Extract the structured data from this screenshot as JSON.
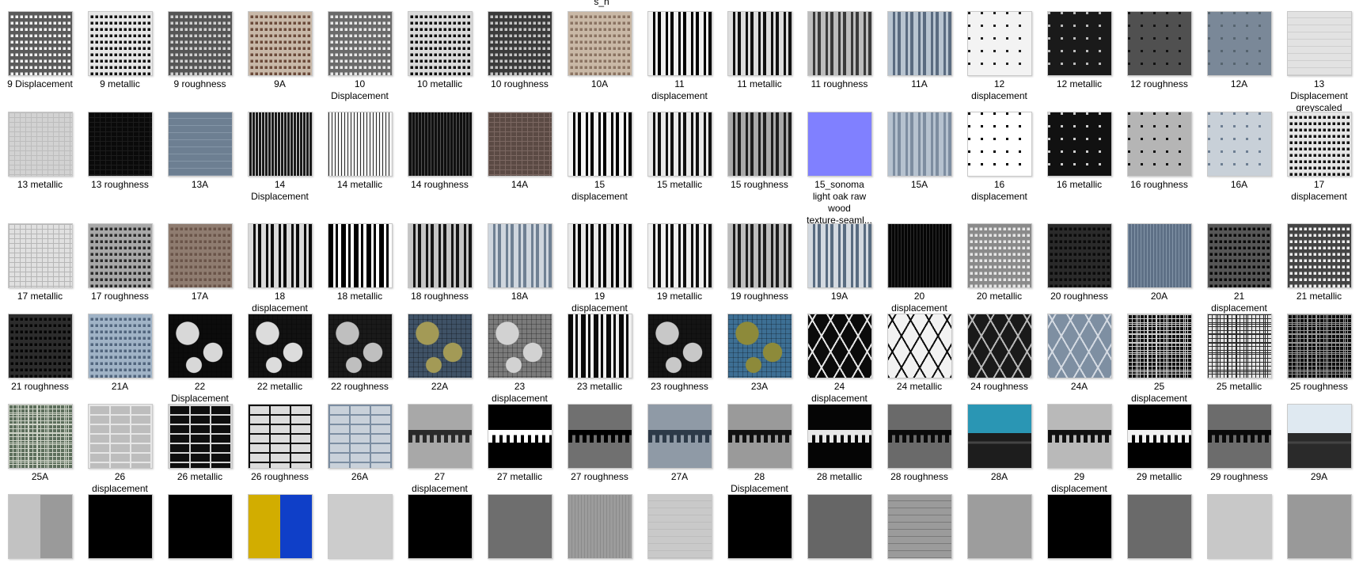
{
  "header_fragment": "s_n",
  "rows": [
    [
      {
        "label": "9 Displacement",
        "style": "grid",
        "bg": "#f2f2f2",
        "fg": "#5a5a5a"
      },
      {
        "label": "9 metallic",
        "style": "grid",
        "bg": "#101010",
        "fg": "#e6e6e6"
      },
      {
        "label": "9 roughness",
        "style": "grid",
        "bg": "#d0d0d0",
        "fg": "#555555"
      },
      {
        "label": "9A",
        "style": "grid",
        "bg": "#6b4a3a",
        "fg": "#c8b8a8"
      },
      {
        "label": "10\nDisplacement",
        "style": "grid",
        "bg": "#e8e8e8",
        "fg": "#6a6a6a"
      },
      {
        "label": "10 metallic",
        "style": "grid",
        "bg": "#0c0c0c",
        "fg": "#dadada"
      },
      {
        "label": "10 roughness",
        "style": "grid",
        "bg": "#c4c4c4",
        "fg": "#3a3a3a"
      },
      {
        "label": "10A",
        "style": "grid",
        "bg": "#8a7362",
        "fg": "#c9b8a6"
      },
      {
        "label": "11\ndisplacement",
        "style": "vbars",
        "bg": "#000000",
        "fg": "#f0f0f0"
      },
      {
        "label": "11 metallic",
        "style": "vbars",
        "bg": "#111111",
        "fg": "#dddddd"
      },
      {
        "label": "11 roughness",
        "style": "vbars",
        "bg": "#3a3a3a",
        "fg": "#bdbdbd"
      },
      {
        "label": "11A",
        "style": "vbars",
        "bg": "#5a6b80",
        "fg": "#b8c4d0"
      },
      {
        "label": "12\ndisplacement",
        "style": "checker",
        "bg": "#f3f3f3",
        "fg": "#202020"
      },
      {
        "label": "12 metallic",
        "style": "checker",
        "bg": "#1a1a1a",
        "fg": "#bcbcbc"
      },
      {
        "label": "12 roughness",
        "style": "checker",
        "bg": "#505050",
        "fg": "#111111"
      },
      {
        "label": "12A",
        "style": "checker",
        "bg": "#7a8898",
        "fg": "#56646f"
      },
      {
        "label": "13\nDisplacement\ngreyscaled",
        "style": "hstripes",
        "bg": "#e2e2e2",
        "fg": "#cfcfcf"
      }
    ],
    [
      {
        "label": "13 metallic",
        "style": "fine",
        "bg": "#d2d2d2",
        "fg": "#bdbdbd"
      },
      {
        "label": "13 roughness",
        "style": "fine",
        "bg": "#0a0a0a",
        "fg": "#1c1c1c"
      },
      {
        "label": "13A",
        "style": "hstripes",
        "bg": "#6d7f92",
        "fg": "#8495a7"
      },
      {
        "label": "14\nDisplacement",
        "style": "vlines",
        "bg": "#1a1a1a",
        "fg": "#e3e3e3"
      },
      {
        "label": "14 metallic",
        "style": "vlines",
        "bg": "#f2f2f2",
        "fg": "#2a2a2a"
      },
      {
        "label": "14 roughness",
        "style": "vlines",
        "bg": "#101010",
        "fg": "#555555"
      },
      {
        "label": "14A",
        "style": "fine",
        "bg": "#5b4a44",
        "fg": "#7b6761"
      },
      {
        "label": "15\ndisplacement",
        "style": "vbars",
        "bg": "#000000",
        "fg": "#f5f5f5"
      },
      {
        "label": "15 metallic",
        "style": "vbars",
        "bg": "#111111",
        "fg": "#e9e9e9"
      },
      {
        "label": "15 roughness",
        "style": "vbars",
        "bg": "#1e1e1e",
        "fg": "#a9a9a9"
      },
      {
        "label": "15_sonoma\nlight oak raw\nwood\ntexture-seaml...",
        "style": "solid",
        "bg": "#8080ff",
        "fg": "#8080ff"
      },
      {
        "label": "15A",
        "style": "vbars",
        "bg": "#7d8da0",
        "fg": "#b6c2cf"
      },
      {
        "label": "16\ndisplacement",
        "style": "checker",
        "bg": "#ffffff",
        "fg": "#000000"
      },
      {
        "label": "16 metallic",
        "style": "checker",
        "bg": "#111111",
        "fg": "#cfcfcf"
      },
      {
        "label": "16 roughness",
        "style": "checker",
        "bg": "#b5b5b5",
        "fg": "#0d0d0d"
      },
      {
        "label": "16A",
        "style": "checker",
        "bg": "#c8d0d8",
        "fg": "#6d7e92"
      },
      {
        "label": "17\ndisplacement",
        "style": "grid",
        "bg": "#121212",
        "fg": "#e6e6e6"
      }
    ],
    [
      {
        "label": "17 metallic",
        "style": "fine",
        "bg": "#e0e0e0",
        "fg": "#b6b6b6"
      },
      {
        "label": "17 roughness",
        "style": "grid",
        "bg": "#2a2a2a",
        "fg": "#a8a8a8"
      },
      {
        "label": "17A",
        "style": "grid",
        "bg": "#6a5449",
        "fg": "#8f7c70"
      },
      {
        "label": "18\ndisplacement",
        "style": "vbars",
        "bg": "#0a0a0a",
        "fg": "#d9d9d9"
      },
      {
        "label": "18 metallic",
        "style": "vbars",
        "bg": "#ffffff",
        "fg": "#000000"
      },
      {
        "label": "18 roughness",
        "style": "vbars",
        "bg": "#151515",
        "fg": "#c5c5c5"
      },
      {
        "label": "18A",
        "style": "vbars",
        "bg": "#6f8093",
        "fg": "#cfd6de"
      },
      {
        "label": "19\ndisplacement",
        "style": "vbars",
        "bg": "#000000",
        "fg": "#e8e8e8"
      },
      {
        "label": "19 metallic",
        "style": "vbars",
        "bg": "#101010",
        "fg": "#f0f0f0"
      },
      {
        "label": "19 roughness",
        "style": "vbars",
        "bg": "#1d1d1d",
        "fg": "#bdbdbd"
      },
      {
        "label": "19A",
        "style": "vbars",
        "bg": "#586b80",
        "fg": "#d3d9e0"
      },
      {
        "label": "20\ndisplacement",
        "style": "vlines",
        "bg": "#060606",
        "fg": "#2e2e2e"
      },
      {
        "label": "20 metallic",
        "style": "grid",
        "bg": "#e6e6e6",
        "fg": "#8a8a8a"
      },
      {
        "label": "20 roughness",
        "style": "grid",
        "bg": "#0a0a0a",
        "fg": "#2a2a2a"
      },
      {
        "label": "20A",
        "style": "vlines",
        "bg": "#5e7086",
        "fg": "#8395a8"
      },
      {
        "label": "21\ndisplacement",
        "style": "grid",
        "bg": "#090909",
        "fg": "#565656"
      },
      {
        "label": "21 metallic",
        "style": "grid",
        "bg": "#eeeeee",
        "fg": "#444444"
      }
    ],
    [
      {
        "label": "21 roughness",
        "style": "grid",
        "bg": "#050505",
        "fg": "#2c2c2c"
      },
      {
        "label": "21A",
        "style": "grid",
        "bg": "#51657d",
        "fg": "#a0b3c6"
      },
      {
        "label": "22\nDisplacement",
        "style": "blotch",
        "bg": "#0c0c0c",
        "fg": "#d8d8d8"
      },
      {
        "label": "22 metallic",
        "style": "blotch",
        "bg": "#121212",
        "fg": "#dcdcdc"
      },
      {
        "label": "22 roughness",
        "style": "blotch",
        "bg": "#1a1a1a",
        "fg": "#bfbfbf"
      },
      {
        "label": "22A",
        "style": "blotch",
        "bg": "#3f5266",
        "fg": "#a39a56"
      },
      {
        "label": "23\ndisplacement",
        "style": "blotch",
        "bg": "#7a7a7a",
        "fg": "#d2d2d2"
      },
      {
        "label": "23 metallic",
        "style": "vbars",
        "bg": "#f0f0f0",
        "fg": "#0a0a0a"
      },
      {
        "label": "23 roughness",
        "style": "blotch",
        "bg": "#141414",
        "fg": "#c8c8c8"
      },
      {
        "label": "23A",
        "style": "blotch",
        "bg": "#3d6f94",
        "fg": "#8d8a3a"
      },
      {
        "label": "24\ndisplacement",
        "style": "diamond",
        "bg": "#0b0b0b",
        "fg": "#e6e6e6"
      },
      {
        "label": "24 metallic",
        "style": "diamond",
        "bg": "#f2f2f2",
        "fg": "#0d0d0d"
      },
      {
        "label": "24 roughness",
        "style": "diamond",
        "bg": "#1a1a1a",
        "fg": "#b8b8b8"
      },
      {
        "label": "24A",
        "style": "diamond",
        "bg": "#7e8fa2",
        "fg": "#d4dae2"
      },
      {
        "label": "25\ndisplacement",
        "style": "circuit",
        "bg": "#101010",
        "fg": "#cfcfcf"
      },
      {
        "label": "25 metallic",
        "style": "circuit",
        "bg": "#e4e4e4",
        "fg": "#2a2a2a"
      },
      {
        "label": "25 roughness",
        "style": "circuit",
        "bg": "#0d0d0d",
        "fg": "#9a9a9a"
      }
    ],
    [
      {
        "label": "25A",
        "style": "circuit",
        "bg": "#5c6e5b",
        "fg": "#cfd4c8"
      },
      {
        "label": "26\ndisplacement",
        "style": "brick",
        "bg": "#bdbdbd",
        "fg": "#e6e6e6"
      },
      {
        "label": "26 metallic",
        "style": "brick",
        "bg": "#0e0e0e",
        "fg": "#d4d4d4"
      },
      {
        "label": "26 roughness",
        "style": "brick",
        "bg": "#dcdcdc",
        "fg": "#0c0c0c"
      },
      {
        "label": "26A",
        "style": "brick",
        "bg": "#c9d1da",
        "fg": "#7b8da1"
      },
      {
        "label": "27\ndisplacement",
        "style": "facade",
        "bg": "#a8a8a8",
        "fg": "#2a2a2a"
      },
      {
        "label": "27 metallic",
        "style": "facade",
        "bg": "#000000",
        "fg": "#ffffff"
      },
      {
        "label": "27 roughness",
        "style": "facade",
        "bg": "#707070",
        "fg": "#000000"
      },
      {
        "label": "27A",
        "style": "facade",
        "bg": "#8f9aa6",
        "fg": "#2d3a48"
      },
      {
        "label": "28\nDisplacement",
        "style": "facade",
        "bg": "#9a9a9a",
        "fg": "#111111"
      },
      {
        "label": "28 metallic",
        "style": "facade",
        "bg": "#050505",
        "fg": "#e8e8e8"
      },
      {
        "label": "28 roughness",
        "style": "facade",
        "bg": "#6a6a6a",
        "fg": "#0a0a0a"
      },
      {
        "label": "28A",
        "style": "sky",
        "bg": "#2a96b4",
        "fg": "#1d1d1d"
      },
      {
        "label": "29\ndisplacement",
        "style": "facade",
        "bg": "#b9b9b9",
        "fg": "#101010"
      },
      {
        "label": "29 metallic",
        "style": "facade",
        "bg": "#000000",
        "fg": "#f2f2f2"
      },
      {
        "label": "29 roughness",
        "style": "facade",
        "bg": "#6c6c6c",
        "fg": "#0a0a0a"
      },
      {
        "label": "29A",
        "style": "sky",
        "bg": "#dfe9f1",
        "fg": "#2a2a2a"
      }
    ],
    [
      {
        "label": "",
        "style": "split",
        "bg": "#c2c2c2",
        "fg": "#9a9a9a"
      },
      {
        "label": "",
        "style": "solid",
        "bg": "#000000",
        "fg": "#000000"
      },
      {
        "label": "",
        "style": "solid",
        "bg": "#000000",
        "fg": "#000000"
      },
      {
        "label": "",
        "style": "split",
        "bg": "#d2ad00",
        "fg": "#0f3fc8"
      },
      {
        "label": "",
        "style": "solid",
        "bg": "#cccccc",
        "fg": "#cccccc"
      },
      {
        "label": "",
        "style": "solid",
        "bg": "#000000",
        "fg": "#000000"
      },
      {
        "label": "",
        "style": "solid",
        "bg": "#6e6e6e",
        "fg": "#6e6e6e"
      },
      {
        "label": "",
        "style": "vlines",
        "bg": "#9c9c9c",
        "fg": "#8a8a8a"
      },
      {
        "label": "",
        "style": "hstripes",
        "bg": "#c9c9c9",
        "fg": "#bdbdbd"
      },
      {
        "label": "",
        "style": "solid",
        "bg": "#000000",
        "fg": "#000000"
      },
      {
        "label": "",
        "style": "solid",
        "bg": "#666666",
        "fg": "#666666"
      },
      {
        "label": "",
        "style": "hstripes",
        "bg": "#9b9b9b",
        "fg": "#7a7a7a"
      },
      {
        "label": "",
        "style": "solid",
        "bg": "#9d9d9d",
        "fg": "#9d9d9d"
      },
      {
        "label": "",
        "style": "solid",
        "bg": "#000000",
        "fg": "#000000"
      },
      {
        "label": "",
        "style": "solid",
        "bg": "#6a6a6a",
        "fg": "#6a6a6a"
      },
      {
        "label": "",
        "style": "solid",
        "bg": "#c8c8c8",
        "fg": "#c8c8c8"
      },
      {
        "label": "",
        "style": "solid",
        "bg": "#999999",
        "fg": "#999999"
      }
    ]
  ]
}
